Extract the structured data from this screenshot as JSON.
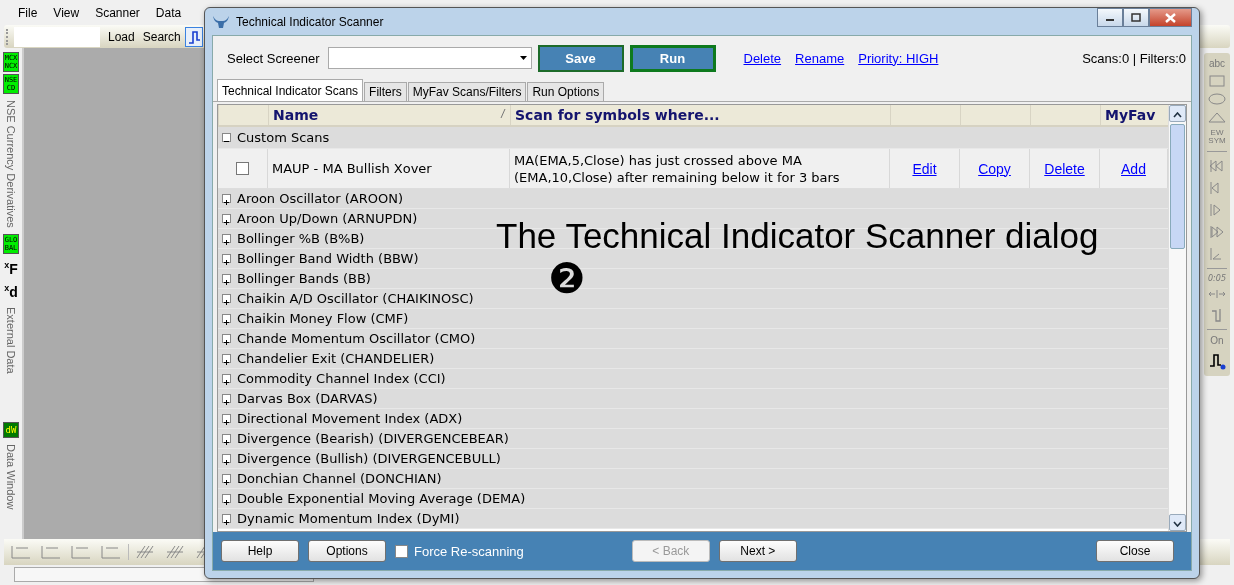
{
  "menu": [
    {
      "label": "File"
    },
    {
      "label": "View"
    },
    {
      "label": "Scanner"
    },
    {
      "label": "Data"
    }
  ],
  "toolbar": {
    "buttons": [
      "Load",
      "Search"
    ]
  },
  "left_panel": [
    {
      "kind": "badge",
      "lines": [
        "MCX",
        "NCX"
      ],
      "color": "#00ee00"
    },
    {
      "kind": "badge",
      "lines": [
        "NSE",
        "CD"
      ],
      "color": "#00ee00"
    },
    {
      "kind": "label",
      "text": "NSE Currency Derivatives"
    },
    {
      "kind": "badge",
      "lines": [
        "GLO",
        "BAL"
      ],
      "color": "#00ee00"
    },
    {
      "kind": "formula",
      "text": "$^{x}$F"
    },
    {
      "kind": "formula",
      "text": "$^{x}$d"
    },
    {
      "kind": "label",
      "text": "External Data"
    },
    {
      "kind": "badge",
      "lines": [
        "dW"
      ],
      "color": "#007a00"
    },
    {
      "kind": "label",
      "text": "Data Window"
    }
  ],
  "right_toolbar": {
    "text_tool": "abc",
    "symbol_tool": [
      "EW",
      "SYM"
    ],
    "time_tool": "0:05",
    "toggle": "On"
  },
  "dialog": {
    "title": "Technical Indicator Scanner",
    "select_label": "Select Screener",
    "buttons": [
      "Save",
      "Run"
    ],
    "links": [
      "Delete",
      "Rename",
      "Priority: HIGH"
    ],
    "counts": "Scans:0 | Filters:0",
    "tabs": [
      {
        "label": "Technical Indicator Scans",
        "selected": true
      },
      {
        "label": "Filters",
        "selected": false
      },
      {
        "label": "MyFav Scans/Filters",
        "selected": false
      },
      {
        "label": "Run Options",
        "selected": false
      }
    ],
    "table": {
      "columns": {
        "name": "Name",
        "condition": "Scan for symbols where...",
        "favorite": "MyFav"
      },
      "groups": [
        {
          "label": "Custom Scans",
          "expanded": true,
          "rows": [
            {
              "checked": false,
              "name": "MAUP - MA Bullish Xover",
              "condition": "MA(EMA,5,Close) has just crossed above MA (EMA,10,Close) after remaining below it for 3 bars",
              "actions": [
                "Edit",
                "Copy",
                "Delete",
                "Add"
              ]
            }
          ]
        },
        {
          "label": "Aroon Oscillator (AROON)",
          "expanded": false
        },
        {
          "label": "Aroon Up/Down (ARNUPDN)",
          "expanded": false
        },
        {
          "label": "Bollinger %B (B%B)",
          "expanded": false
        },
        {
          "label": "Bollinger Band Width (BBW)",
          "expanded": false
        },
        {
          "label": "Bollinger Bands (BB)",
          "expanded": false
        },
        {
          "label": "Chaikin A/D Oscillator (CHAIKINOSC)",
          "expanded": false
        },
        {
          "label": "Chaikin Money Flow (CMF)",
          "expanded": false
        },
        {
          "label": "Chande Momentum Oscillator (CMO)",
          "expanded": false
        },
        {
          "label": "Chandelier Exit (CHANDELIER)",
          "expanded": false
        },
        {
          "label": "Commodity Channel Index (CCI)",
          "expanded": false
        },
        {
          "label": "Darvas Box (DARVAS)",
          "expanded": false
        },
        {
          "label": "Directional Movement Index (ADX)",
          "expanded": false
        },
        {
          "label": "Divergence (Bearish) (DIVERGENCEBEAR)",
          "expanded": false
        },
        {
          "label": "Divergence (Bullish) (DIVERGENCEBULL)",
          "expanded": false
        },
        {
          "label": "Donchian Channel (DONCHIAN)",
          "expanded": false
        },
        {
          "label": "Double Exponential Moving Average (DEMA)",
          "expanded": false
        },
        {
          "label": "Dynamic Momentum Index (DyMI)",
          "expanded": false
        }
      ]
    },
    "footer": {
      "buttons": [
        "Help",
        "Options"
      ],
      "force_rescan": {
        "label": "Force Re-scanning",
        "checked": false
      },
      "nav": [
        {
          "label": "< Back",
          "disabled": true
        },
        {
          "label": "Next >",
          "disabled": false
        }
      ],
      "close": "Close"
    }
  },
  "annotation": {
    "text": "The Technical Indicator Scanner dialog",
    "marker": "❷"
  }
}
